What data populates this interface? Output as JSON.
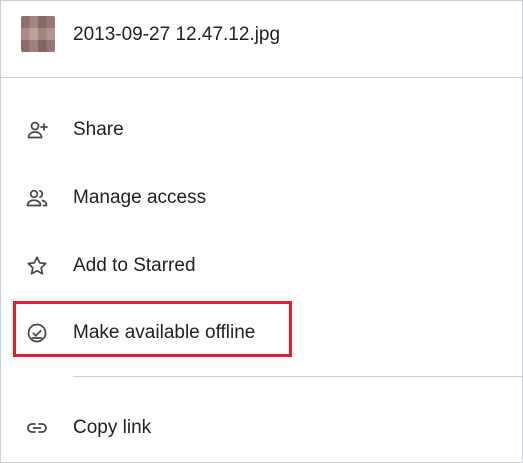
{
  "file": {
    "name": "2013-09-27 12.47.12.jpg",
    "thumbnail_icon": "image-thumbnail"
  },
  "menu": {
    "items": [
      {
        "label": "Share",
        "icon": "person-add-icon"
      },
      {
        "label": "Manage access",
        "icon": "people-icon"
      },
      {
        "label": "Add to Starred",
        "icon": "star-outline-icon"
      },
      {
        "label": "Make available offline",
        "icon": "offline-check-icon",
        "highlighted": true
      },
      {
        "label": "Copy link",
        "icon": "link-icon"
      }
    ]
  },
  "colors": {
    "highlight": "#e0202e",
    "text": "#202124",
    "icon": "#444746",
    "divider": "#c9ced3"
  }
}
